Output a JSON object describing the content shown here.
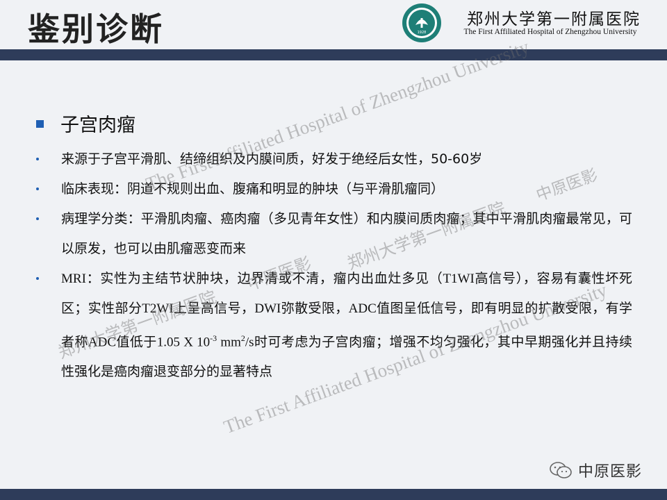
{
  "header": {
    "title": "鉴别诊断",
    "hospital_cn": "郑州大学第一附属医院",
    "hospital_en": "The First Affiliated Hospital of Zhengzhou University",
    "logo_year": "1928"
  },
  "content": {
    "heading": "子宫肉瘤",
    "items": [
      {
        "text": "来源于子宫平滑肌、结缔组织及内膜间质，好发于绝经后女性，50-60岁"
      },
      {
        "text": "临床表现：阴道不规则出血、腹痛和明显的肿块（与平滑肌瘤同）"
      },
      {
        "text": "病理学分类：平滑肌肉瘤、癌肉瘤（多见青年女性）和内膜间质肉瘤；其中平滑肌肉瘤最常见，可以原发，也可以由肌瘤恶变而来"
      }
    ],
    "mri": {
      "p1": "MRI",
      "p2": "：实性为主结节状肿块，边界清或不清，瘤内出血灶多见（",
      "p3": "T1WI",
      "p4": "高信号），容易有囊性坏死区；实性部分",
      "p5": "T2WI",
      "p6": "上呈高信号，",
      "p7": "DWI",
      "p8": "弥散受限，",
      "p9": "ADC",
      "p10": "值图呈低信号，即有明显的扩散受限，有学者称",
      "p11": "ADC",
      "p12": "值低于",
      "p13": "1.05 X 10",
      "p14": "-3",
      "p15": " mm",
      "p16": "2",
      "p17": "/s",
      "p18": "时可考虑为子宫肉瘤；增强不均匀强化，其中早期强化并且持续性强化是癌肉瘤退变部分的显著特点"
    }
  },
  "watermarks": {
    "en1": "The First Affiliated Hospital of Zhengzhou University",
    "cn_brand": "中原医影",
    "cn_hospital_a": "郑州大学第一附属医院",
    "cn_brand_b": "中原医影",
    "cn_hospital_b": "郑州大学第一附属医院",
    "en2": "The First Affiliated Hospital of Zhengzhou University"
  },
  "footer": {
    "brand": "中原医影"
  },
  "colors": {
    "bar": "#2e3c5a",
    "bullet": "#1f5fb3",
    "logo": "#1e7f77"
  }
}
